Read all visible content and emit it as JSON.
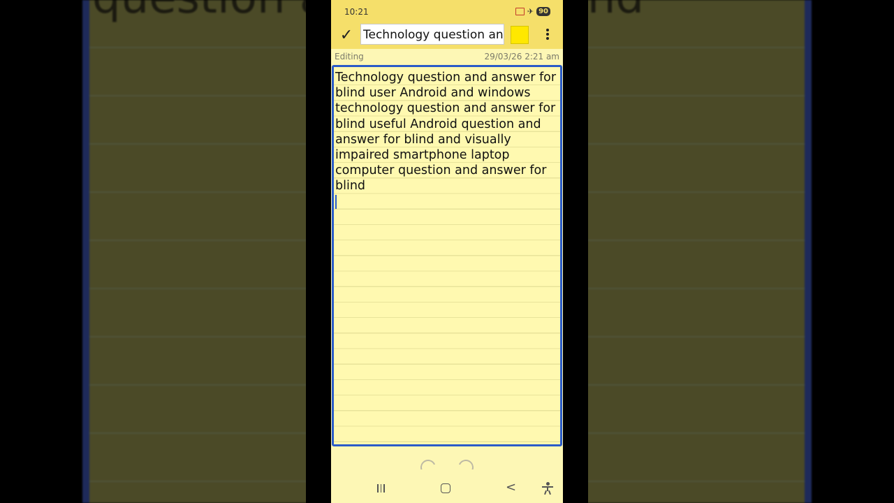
{
  "background": {
    "text_left": "question an",
    "text_right": "lind"
  },
  "status_bar": {
    "time": "10:21",
    "battery": "90"
  },
  "toolbar": {
    "title_value": "Technology question an",
    "swatch_color": "#ffe800"
  },
  "meta": {
    "mode": "Editing",
    "timestamp": "29/03/26 2:21 am"
  },
  "note": {
    "body": "Technology question and answer for blind user Android and windows technology question and answer for blind useful Android question and answer for blind and visually impaired smartphone laptop computer question and answer for blind"
  },
  "colors": {
    "toolbar_bg": "#f5df6a",
    "note_bg": "#fff9b0",
    "editor_border": "#2a5bc8"
  }
}
